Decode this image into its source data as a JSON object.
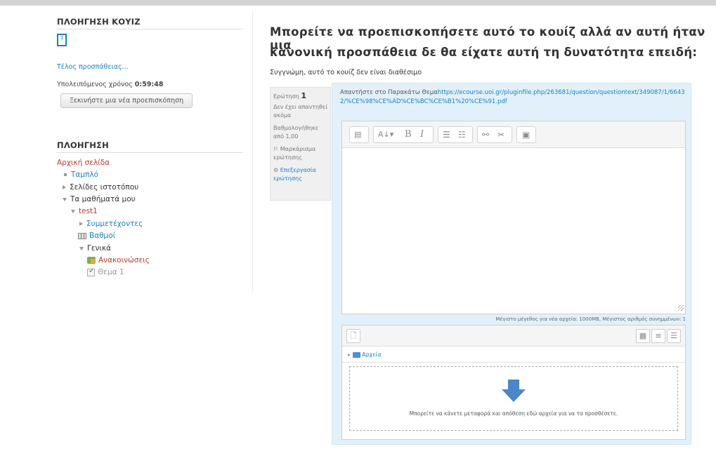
{
  "quiz_nav": {
    "title": "ΠΛΟΗΓΗΣΗ ΚΟΥΙΖ",
    "question_number": "1",
    "finish_link": "Τέλος προσπάθειας...",
    "time_label": "Υπολειπόμενος χρόνος",
    "time_value": "0:59:48",
    "new_preview_button": "Ξεκινήστε μια νέα προεπισκόπηση"
  },
  "navigation": {
    "title": "ΠΛΟΗΓΗΣΗ",
    "home": "Αρχική σελίδα",
    "dashboard": "Ταμπλό",
    "site_pages": "Σελίδες ιστοτόπου",
    "my_courses": "Τα μαθήματά μου",
    "course": "test1",
    "participants": "Συμμετέχοντες",
    "grades": "Βαθμοί",
    "general": "Γενικά",
    "announcements": "Ανακοινώσεις",
    "topic": "Θεμα 1"
  },
  "main": {
    "heading_line1": "Μπορείτε να προεπισκοπήσετε αυτό το κουίζ αλλά αν αυτή ήταν μια",
    "heading_line2": "κανονική προσπάθεια δε θα είχατε αυτή τη δυνατότητα επειδή:",
    "reason": "Συγγνώμη, αυτό το κουίζ δεν είναι διαθέσιμο"
  },
  "question_info": {
    "label": "Ερώτηση",
    "number": "1",
    "status": "Δεν έχει απαντηθεί ακόμα",
    "marks": "Βαθμολογήθηκε από 1,00",
    "flag": "Μαρκάρισμα ερώτησης",
    "edit": "Επεξεργασία ερώτησης"
  },
  "question": {
    "text": "Απαντήστε στο Παρακάτω Θεμα",
    "url": "https://ecourse.uoi.gr/pluginfile.php/263681/question/questiontext/349087/1/66432/%CE%98%CE%AD%CE%BC%CE%B1%20%CE%91.pdf"
  },
  "editor": {
    "toolbar_icons": [
      "show-more-icon",
      "paragraph-style-icon",
      "bold-icon",
      "italic-icon",
      "unordered-list-icon",
      "ordered-list-icon",
      "link-icon",
      "unlink-icon",
      "image-icon"
    ],
    "bold_glyph": "B",
    "italic_glyph": "I",
    "limits": "Μέγιστο μέγεθος για νέα αρχεία: 1000MB, Μέγιστος αριθμός συνημμένων: 1"
  },
  "filemanager": {
    "folder_label": "Αρχεία",
    "drop_text": "Μπορείτε να κάνετε μεταφορά και απόθεση εδώ αρχεία για να τα προσθέσετε."
  },
  "colors": {
    "link": "#1a7fc4",
    "home_red": "#c0392b",
    "panel_bg": "#e2f1f9",
    "arrow": "#4a86c8"
  }
}
